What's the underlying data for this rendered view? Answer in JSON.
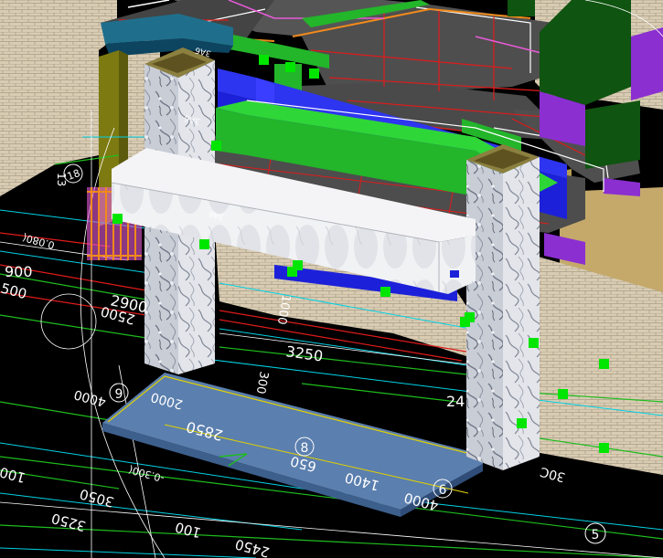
{
  "viewport": {
    "background": "#000000"
  },
  "colors": {
    "wall": "#d9ccb3",
    "wall_dark": "#a89e87",
    "floor_slab": "#555555",
    "beam_green": "#23b52a",
    "beam_blue": "#1c21d9",
    "column_marble": "#c9cdd6",
    "foundation": "#5b7fae",
    "cyan_line": "#00d2e5",
    "red_line": "#e01b1b",
    "green_line": "#1ebd1e",
    "yellow_line": "#e0d000",
    "magenta": "#c41ab8",
    "node": "#00e600",
    "olive": "#7d7a12",
    "tan": "#c4a96a",
    "dark_green": "#0f5410",
    "purple": "#8b2fd1"
  },
  "dimensions": {
    "d_900": "900",
    "d_500": "500",
    "d_2900": "2900",
    "d_2500": "2500",
    "d_1000": "1000",
    "d_3250": "3250",
    "d_300": "300",
    "d_24": "24",
    "d_4000_left": "4000",
    "d_2000": "2000",
    "d_2850": "2850",
    "d_650": "650",
    "d_1400": "1400",
    "d_4000_bottom": "4000",
    "d_3050": "3050",
    "d_3250_bottom": "3250",
    "d_100_left": "100",
    "d_100_bottom": "100",
    "d_2450": "2450",
    "d_30c": "30C",
    "d_elev_top": "0.080(",
    "d_elev": "-0.300(",
    "d_beam_1": "3A6",
    "d_beam_2": "3A6",
    "d_beam_3": "3A6",
    "d_rot_13": "13"
  },
  "axis_bubbles": {
    "b9": "9",
    "b8": "8",
    "b6": "6",
    "b5": "5",
    "b18": "18"
  }
}
